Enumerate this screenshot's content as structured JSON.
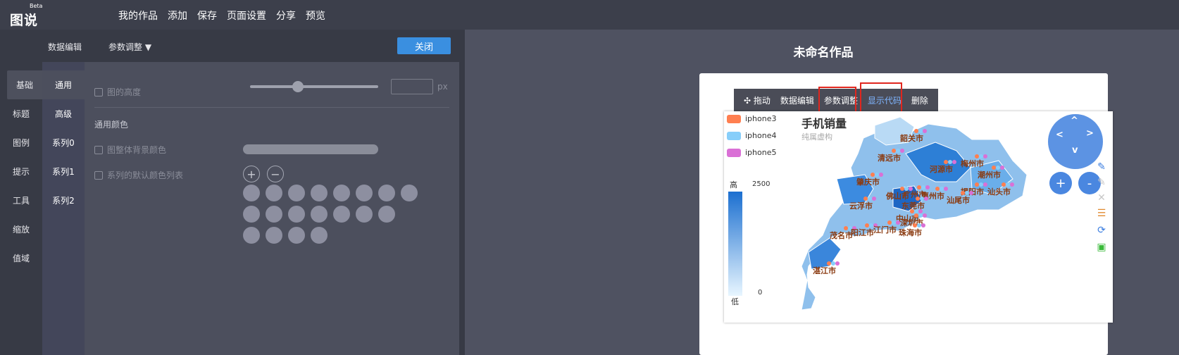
{
  "app": {
    "logo": "图说",
    "beta": "Beta"
  },
  "topmenu": [
    "我的作品",
    "添加",
    "保存",
    "页面设置",
    "分享",
    "预览"
  ],
  "editor": {
    "tab_data": "数据编辑",
    "tab_params": "参数调整 ▼",
    "close_label": "关闭",
    "vtabs": [
      "基础",
      "标题",
      "图例",
      "提示",
      "工具",
      "缩放",
      "值域"
    ],
    "v2tabs": [
      "通用",
      "高级",
      "系列0",
      "系列1",
      "系列2"
    ],
    "height_label": "图的高度",
    "px_label": "px",
    "section_color": "通用颜色",
    "bg_color_label": "图整体背景颜色",
    "series_color_label": "系列的默认颜色列表",
    "add_symbol": "+",
    "remove_symbol": "−"
  },
  "preview": {
    "page_title": "未命名作品",
    "toolbar": {
      "drag": "✣ 拖动",
      "data_edit": "数据编辑",
      "params": "参数调整",
      "show_code": "显示代码",
      "delete": "删除"
    }
  },
  "chart_data": {
    "type": "map",
    "title": "手机销量",
    "subtitle": "纯属虚构",
    "legend": [
      {
        "name": "iphone3",
        "color": "#ff7f50"
      },
      {
        "name": "iphone4",
        "color": "#87cefa"
      },
      {
        "name": "iphone5",
        "color": "#da70d6"
      }
    ],
    "visual_map": {
      "high_label": "高",
      "low_label": "低",
      "max": 2500,
      "min": 0,
      "max_text": "2500",
      "min_text": "0"
    },
    "regions": [
      "韶关市",
      "清远市",
      "河源市",
      "梅州市",
      "潮州市",
      "肇庆市",
      "广州市",
      "惠州市",
      "揭阳市",
      "汕头市",
      "佛山市",
      "汕尾市",
      "云浮市",
      "东莞市",
      "中山市",
      "深圳市",
      "茂名市",
      "阳江市",
      "江门市",
      "珠海市",
      "湛江市"
    ]
  },
  "nav": {
    "up": "^",
    "left": "<",
    "right": ">",
    "down": "v",
    "zoom_in": "+",
    "zoom_out": "-"
  }
}
